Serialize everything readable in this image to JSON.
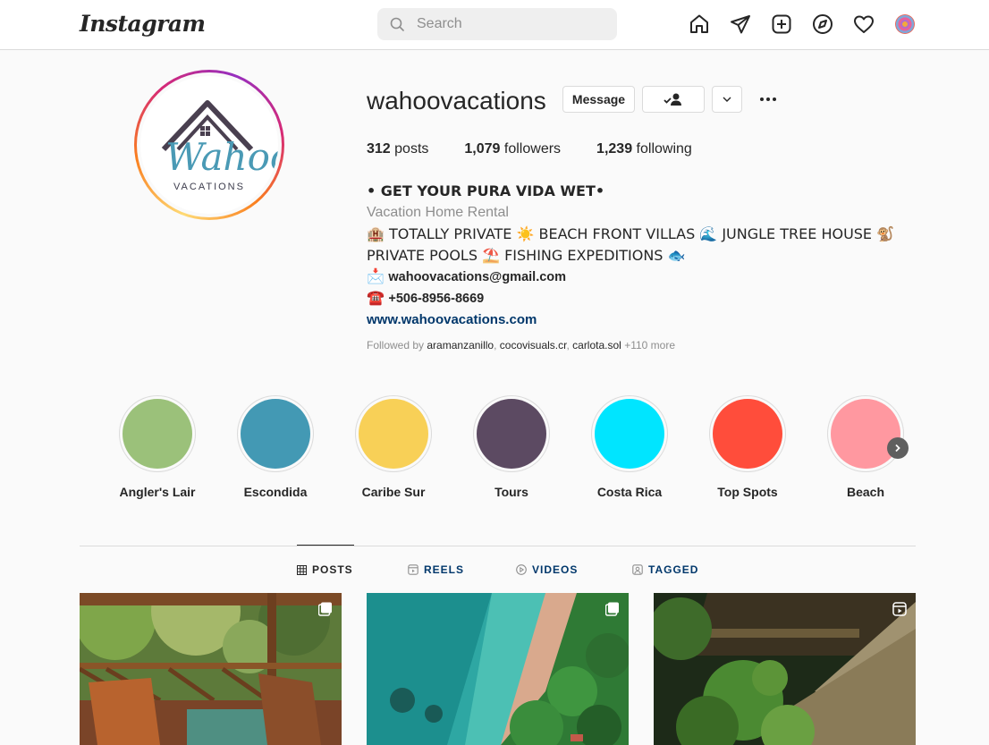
{
  "header": {
    "logo": "Instagram",
    "search": {
      "placeholder": "Search"
    },
    "icons": [
      "home-icon",
      "paper-plane-icon",
      "new-post-icon",
      "explore-icon",
      "heart-icon",
      "profile-avatar"
    ]
  },
  "profile": {
    "username": "wahoovacations",
    "avatar_text": {
      "script": "Wahoo",
      "sub": "VACATIONS"
    },
    "message_label": "Message",
    "stats": [
      {
        "count": "312",
        "label": "posts"
      },
      {
        "count": "1,079",
        "label": "followers"
      },
      {
        "count": "1,239",
        "label": "following"
      }
    ],
    "bio": {
      "line1": "• GET YOUR PURA VIDA WET•",
      "category": "Vacation Home Rental",
      "line3": "🏨 TOTALLY PRIVATE ☀️ BEACH FRONT VILLAS 🌊 JUNGLE TREE HOUSE 🐒",
      "line4": "PRIVATE POOLS ⛱️ FISHING EXPEDITIONS 🐟",
      "email": "wahoovacations@gmail.com",
      "phone": "+506-8956-8669",
      "website": "www.wahoovacations.com"
    },
    "followed_by": {
      "prefix": "Followed by",
      "users": [
        "aramanzanillo",
        "cocovisuals.cr",
        "carlota.sol"
      ],
      "more": "+110 more"
    }
  },
  "highlights": [
    {
      "label": "Angler's Lair",
      "color": "#9bc17a"
    },
    {
      "label": "Escondida",
      "color": "#4399b4"
    },
    {
      "label": "Caribe Sur",
      "color": "#f8d057"
    },
    {
      "label": "Tours",
      "color": "#5c4a62"
    },
    {
      "label": "Costa Rica",
      "color": "#00e5ff"
    },
    {
      "label": "Top Spots",
      "color": "#ff4d3b"
    },
    {
      "label": "Beach",
      "color": "#ff98a0"
    }
  ],
  "tabs": [
    {
      "label": "POSTS",
      "icon": "grid-icon",
      "active": true
    },
    {
      "label": "REELS",
      "icon": "reels-icon",
      "active": false
    },
    {
      "label": "VIDEOS",
      "icon": "play-icon",
      "active": false
    },
    {
      "label": "TAGGED",
      "icon": "tagged-icon",
      "active": false
    }
  ],
  "posts": [
    {
      "name": "jungle-terrace-post",
      "badge": "carousel-icon"
    },
    {
      "name": "aerial-beach-post",
      "badge": "carousel-icon"
    },
    {
      "name": "palapa-garden-post",
      "badge": "reel-icon"
    }
  ]
}
